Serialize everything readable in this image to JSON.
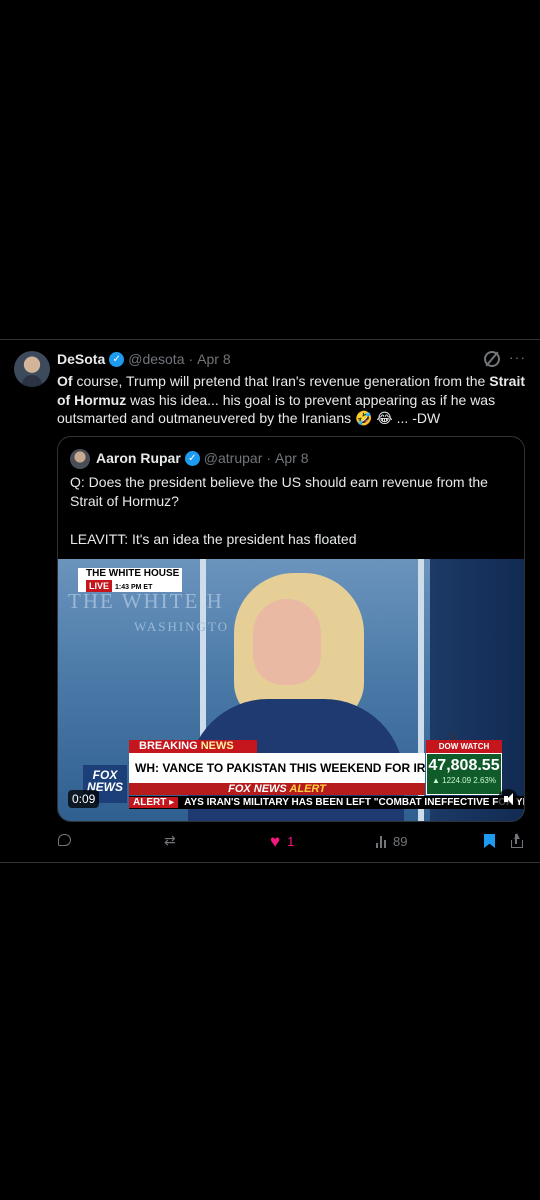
{
  "tweet": {
    "author_name": "DeSota",
    "author_handle": "@desota",
    "separator": "·",
    "date": "Apr 8",
    "more_label": "···",
    "text_part1": "Of",
    "text_part2": " course, Trump will pretend that Iran's revenue generation from the ",
    "text_part3": "Strait of Hormuz",
    "text_part4": " was his idea... his goal is to prevent appearing as if he was outsmarted and outmaneuvered by the Iranians 🤣 😂 ...  -DW"
  },
  "quote": {
    "author_name": "Aaron Rupar",
    "author_handle": "@atrupar",
    "separator": "·",
    "date": "Apr 8",
    "line1": "Q: Does the president believe the US should earn revenue from the Strait of Hormuz?",
    "line2": "LEAVITT: It's an idea the president has floated"
  },
  "video": {
    "wall_text": "THE WHITE H",
    "wall_subtext": "WASHINGTO",
    "wh_tag": "THE WHITE HOUSE",
    "live": "LIVE",
    "live_time": "1:43 PM ET",
    "fox_logo_line1": "FOX",
    "fox_logo_line2": "NEWS",
    "breaking_a": "BREAKING",
    "breaking_b": "NEWS",
    "headline": "WH: VANCE TO PAKISTAN THIS WEEKEND FOR IRAN TALKS",
    "alert_a": "FOX NEWS",
    "alert_b": "ALERT",
    "dow_label": "DOW WATCH",
    "dow_value": "47,808.55",
    "dow_change": "▲ 1224.09  2.63%",
    "ticker_label": "ALERT ▸",
    "ticker_text": "AYS IRAN'S MILITARY HAS BEEN LEFT \"COMBAT INEFFECTIVE FOR YEARS TO COME",
    "duration": "0:09"
  },
  "actions": {
    "likes": "1",
    "views": "89"
  },
  "colors": {
    "background": "#000000",
    "text": "#e7e9ea",
    "muted": "#71767b",
    "verified": "#1d9bf0",
    "like": "#f91880",
    "bookmark": "#1d9bf0"
  },
  "icons": [
    "grok-icon",
    "more-icon",
    "verified-icon",
    "reply-icon",
    "retweet-icon",
    "heart-icon",
    "views-icon",
    "bookmark-icon",
    "share-icon",
    "volume-icon"
  ]
}
